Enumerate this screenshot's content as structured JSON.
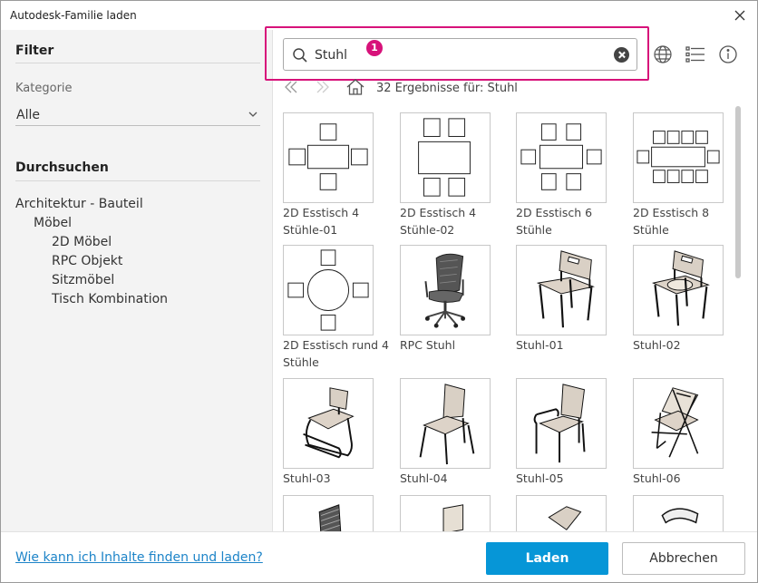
{
  "window": {
    "title": "Autodesk-Familie laden"
  },
  "filter": {
    "heading": "Filter",
    "category_label": "Kategorie",
    "category_value": "Alle"
  },
  "browse": {
    "heading": "Durchsuchen",
    "tree": [
      {
        "label": "Architektur - Bauteil",
        "level": 0
      },
      {
        "label": "Möbel",
        "level": 1
      },
      {
        "label": "2D Möbel",
        "level": 2
      },
      {
        "label": "RPC Objekt",
        "level": 2
      },
      {
        "label": "Sitzmöbel",
        "level": 2
      },
      {
        "label": "Tisch Kombination",
        "level": 2
      }
    ]
  },
  "search": {
    "value": "Stuhl",
    "badge": "1"
  },
  "toolbar": {
    "globe_icon": "globe-icon",
    "list_icon": "list-view-icon",
    "info_icon": "info-icon"
  },
  "results": {
    "text": "32 Ergebnisse für: Stuhl"
  },
  "items": [
    {
      "label": "2D Esstisch 4 Stühle-01"
    },
    {
      "label": "2D Esstisch 4 Stühle-02"
    },
    {
      "label": "2D Esstisch 6 Stühle"
    },
    {
      "label": "2D Esstisch 8 Stühle"
    },
    {
      "label": "2D Esstisch rund 4 Stühle"
    },
    {
      "label": "RPC Stuhl"
    },
    {
      "label": "Stuhl-01"
    },
    {
      "label": "Stuhl-02"
    },
    {
      "label": "Stuhl-03"
    },
    {
      "label": "Stuhl-04"
    },
    {
      "label": "Stuhl-05"
    },
    {
      "label": "Stuhl-06"
    },
    {
      "label": ""
    },
    {
      "label": ""
    },
    {
      "label": ""
    },
    {
      "label": ""
    }
  ],
  "footer": {
    "help_link": "Wie kann ich Inhalte finden und laden?",
    "load_button": "Laden",
    "cancel_button": "Abbrechen"
  },
  "colors": {
    "accent": "#0696d7",
    "highlight": "#d7127a",
    "link": "#1d84c8"
  }
}
